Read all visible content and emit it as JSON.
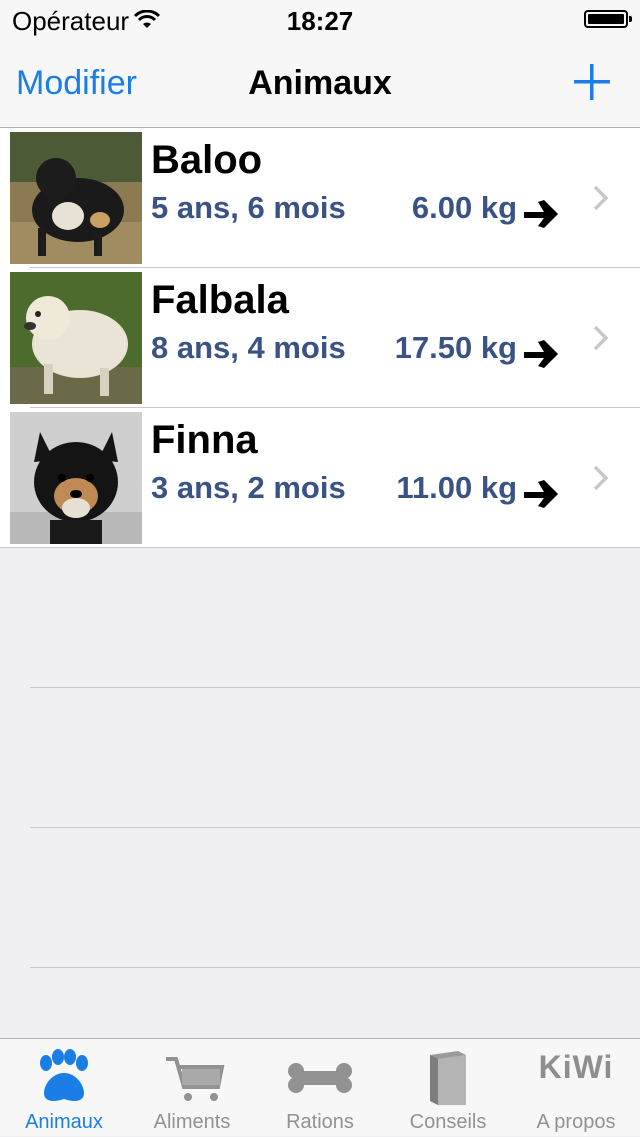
{
  "status_bar": {
    "carrier": "Opérateur",
    "time": "18:27"
  },
  "nav": {
    "edit_label": "Modifier",
    "title": "Animaux",
    "add_icon": "plus-icon"
  },
  "animals": [
    {
      "name": "Baloo",
      "age": "5 ans, 6 mois",
      "weight": "6.00 kg",
      "trend_icon": "arrow-right-icon"
    },
    {
      "name": "Falbala",
      "age": "8 ans, 4 mois",
      "weight": "17.50 kg",
      "trend_icon": "arrow-right-icon"
    },
    {
      "name": "Finna",
      "age": "3 ans, 2 mois",
      "weight": "11.00 kg",
      "trend_icon": "arrow-right-icon"
    }
  ],
  "tabs": [
    {
      "label": "Animaux",
      "icon": "paw-icon",
      "active": true
    },
    {
      "label": "Aliments",
      "icon": "cart-icon",
      "active": false
    },
    {
      "label": "Rations",
      "icon": "bone-icon",
      "active": false
    },
    {
      "label": "Conseils",
      "icon": "book-icon",
      "active": false
    },
    {
      "label": "A propos",
      "icon": "kiwi-logo",
      "logo_text": "KiWi",
      "active": false
    }
  ],
  "colors": {
    "accent": "#1a7ee6",
    "detail_text": "#3a5384",
    "inactive_tab": "#929292"
  }
}
